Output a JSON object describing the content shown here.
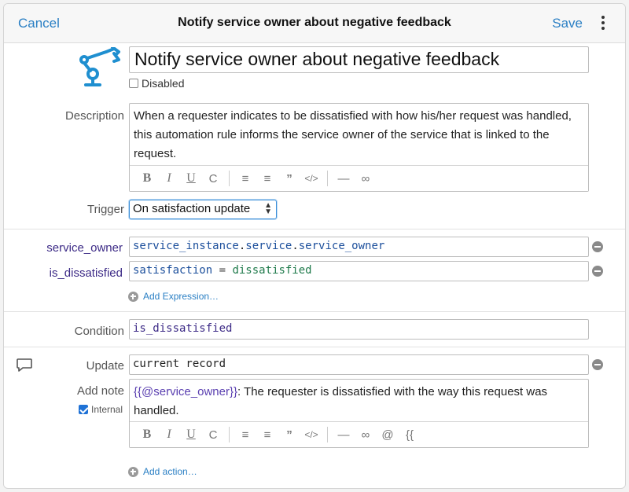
{
  "header": {
    "cancel_label": "Cancel",
    "title": "Notify service owner about negative feedback",
    "save_label": "Save"
  },
  "rule": {
    "name": "Notify service owner about negative feedback",
    "disabled_label": "Disabled",
    "disabled": false
  },
  "description": {
    "label": "Description",
    "text": "When a requester indicates to be dissatisfied with how his/her request was handled, this automation rule informs the service owner of the service that is linked to the request."
  },
  "trigger": {
    "label": "Trigger",
    "value": "On satisfaction update"
  },
  "expressions": [
    {
      "name": "service_owner",
      "parts": [
        "service_instance",
        ".",
        "service",
        ".",
        "service_owner"
      ]
    },
    {
      "name": "is_dissatisfied",
      "parts": [
        "satisfaction",
        " = ",
        "dissatisfied"
      ]
    }
  ],
  "add_expression_label": "Add Expression…",
  "condition": {
    "label": "Condition",
    "value": "is_dissatisfied"
  },
  "update": {
    "label": "Update",
    "value": "current record"
  },
  "note": {
    "label": "Add note",
    "internal_label": "Internal",
    "internal": true,
    "variable": "{{@service_owner}}",
    "text_line1": ": The requester is dissatisfied with the way this request was",
    "text_line2": "handled."
  },
  "toolbar": {
    "extra_at": "@",
    "extra_braces": "{{"
  },
  "add_action_label": "Add action…",
  "colors": {
    "accent": "#2a7fc4",
    "variable": "#3c2a86",
    "attribute": "#1c4f9c",
    "value": "#1f7a4b",
    "icon": "#1f8fd0"
  }
}
